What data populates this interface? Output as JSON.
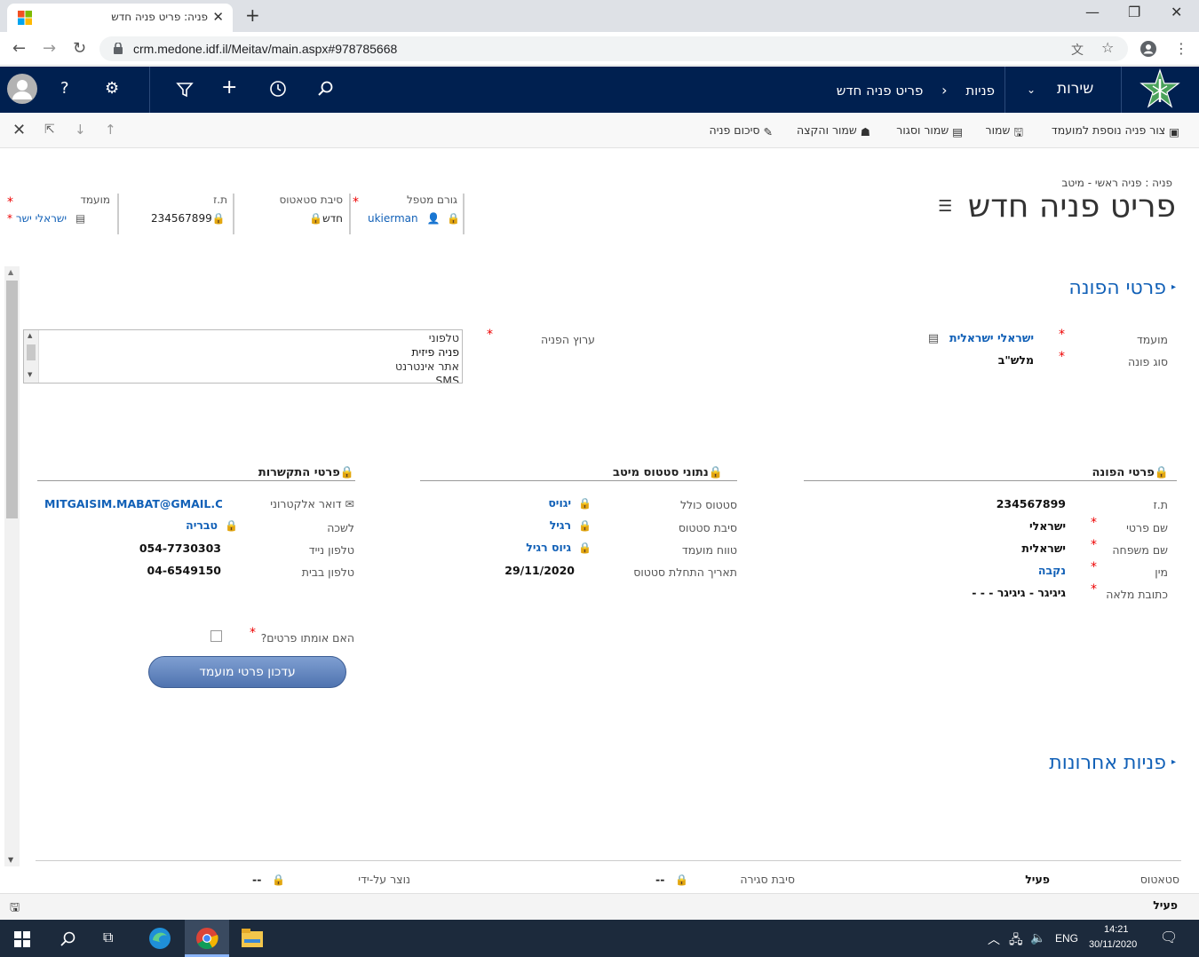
{
  "browser": {
    "tab_title": "פניה: פריט פניה חדש",
    "url": "crm.medone.idf.il/Meitav/main.aspx#978785668",
    "icons": [
      "windows-logo-icon",
      "close-icon",
      "plus-icon",
      "minimize-icon",
      "restore-icon",
      "back-icon",
      "forward-icon",
      "reload-icon",
      "lock-icon",
      "translate-icon",
      "star-icon",
      "account-icon",
      "menu-icon"
    ]
  },
  "crm_nav": {
    "service": "שירות",
    "inquiries": "פניות",
    "breadcrumb_item": "פריט פניה חדש",
    "chevron": "‹",
    "help": "?"
  },
  "commands": {
    "new_for_patient": "צור פניה נוספת למועמד",
    "save": "שמור",
    "save_close": "שמור וסגור",
    "save_assign": "שמור והקצה",
    "summary": "סיכום פניה"
  },
  "header": {
    "breadcrumb": "פניה : פניה ראשי - מיטב",
    "title": "פריט פניה חדש",
    "fields": [
      {
        "label": "גורם מטפל",
        "value": "ukierman"
      },
      {
        "label": "סיבת סטאטוס",
        "value": "חדש"
      },
      {
        "label": "ת.ז",
        "value": "234567899"
      },
      {
        "label": "מועמד",
        "value": "ישראלי ישר"
      }
    ]
  },
  "section_inquirer": {
    "title": "פרטי הפונה",
    "candidate_label": "מועמד",
    "candidate_value": "ישראלי ישראלית",
    "type_label": "סוג פונה",
    "type_value": "מלש\"ב",
    "channel_label": "ערוץ הפניה",
    "channel_options": [
      "טלפוני",
      "פניה פיזית",
      "אתר אינטרנט",
      "SMS"
    ]
  },
  "sub_inquirer": {
    "title": "פרטי הפונה",
    "rows": [
      {
        "label": "ת.ז",
        "value": "234567899"
      },
      {
        "label": "שם פרטי",
        "value": "ישראלי"
      },
      {
        "label": "שם משפחה",
        "value": "ישראלית"
      },
      {
        "label": "מין",
        "value": "נקבה"
      },
      {
        "label": "כתובת מלאה",
        "value": "גיגיגר - גיגיגר - - -"
      }
    ]
  },
  "sub_status": {
    "title": "נתוני סטטוס מיטב",
    "rows": [
      {
        "label": "סטטוס כולל",
        "value": "יגויס"
      },
      {
        "label": "סיבת סטטוס",
        "value": "רגיל"
      },
      {
        "label": "טווח מועמד",
        "value": "גיוס רגיל"
      },
      {
        "label": "תאריך התחלת סטטוס",
        "value": "29/11/2020"
      }
    ]
  },
  "sub_contact": {
    "title": "פרטי התקשרות",
    "rows": [
      {
        "label": "דואר אלקטרוני",
        "value": "MITGAISIM.MABAT@GMAIL.COM"
      },
      {
        "label": "לשכה",
        "value": "טבריה"
      },
      {
        "label": "טלפון נייד",
        "value": "054-7730303"
      },
      {
        "label": "טלפון בבית",
        "value": "04-6549150"
      }
    ],
    "verify_label": "האם אומתו פרטים?",
    "update_button": "עדכון פרטי מועמד"
  },
  "section_recent": {
    "title": "פניות אחרונות"
  },
  "footer": {
    "status_label": "סטאטוס",
    "status_value": "פעיל",
    "close_reason_label": "סיבת סגירה",
    "close_reason_value": "--",
    "created_by_label": "נוצר על-ידי",
    "created_by_value": "--",
    "bottom_status": "פעיל"
  },
  "taskbar": {
    "lang": "ENG",
    "time": "14:21",
    "date": "30/11/2020"
  }
}
